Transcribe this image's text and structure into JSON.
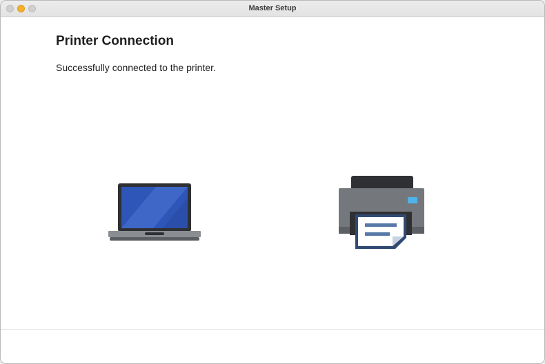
{
  "window": {
    "title": "Master Setup"
  },
  "main": {
    "heading": "Printer Connection",
    "status_message": "Successfully connected to the printer."
  },
  "icons": {
    "laptop": "laptop-icon",
    "printer": "printer-icon"
  }
}
